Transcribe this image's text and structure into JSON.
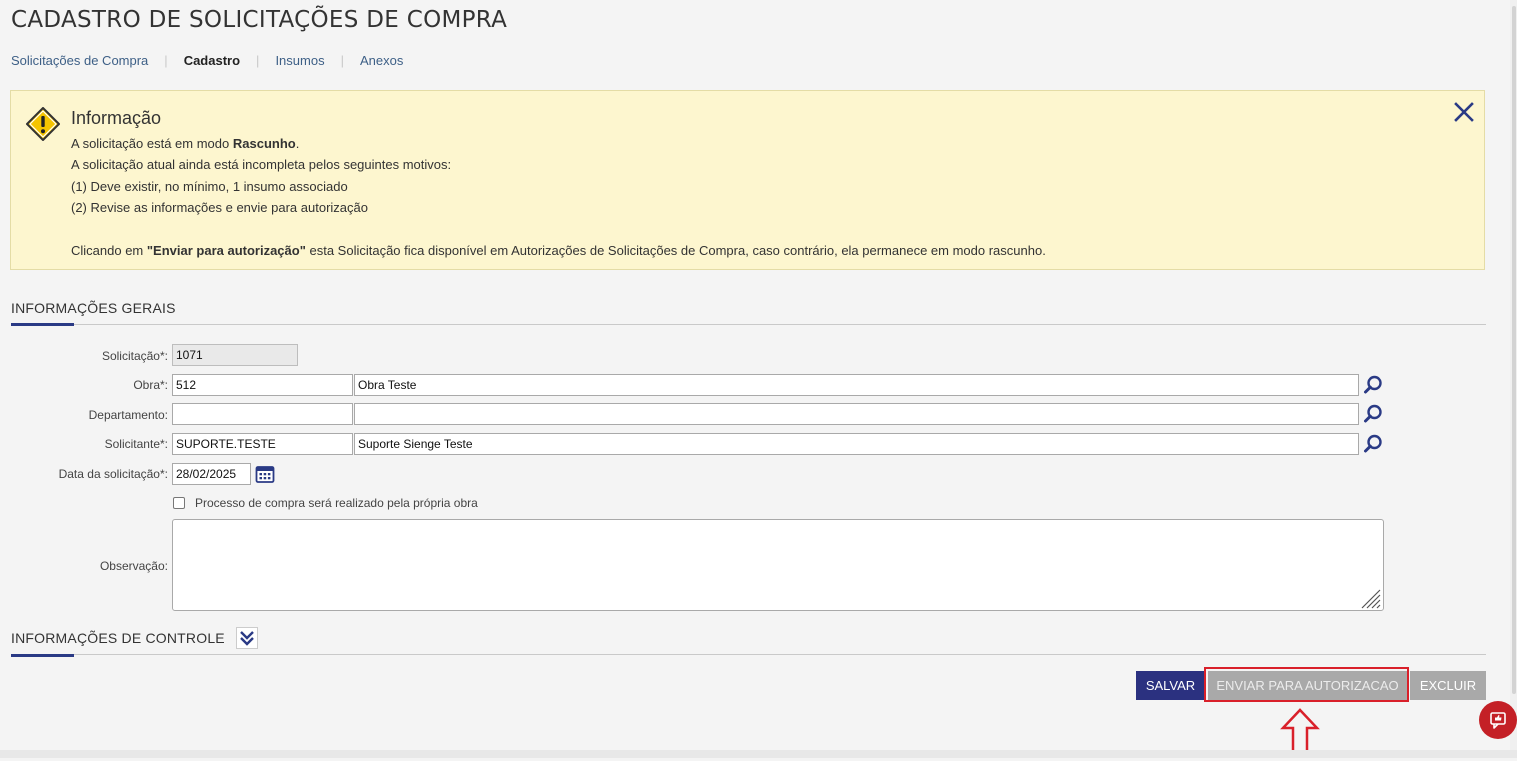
{
  "page_title": "CADASTRO DE SOLICITAÇÕES DE COMPRA",
  "breadcrumb": [
    {
      "label": "Solicitações de Compra",
      "active": false
    },
    {
      "label": "Cadastro",
      "active": true
    },
    {
      "label": "Insumos",
      "active": false
    },
    {
      "label": "Anexos",
      "active": false
    }
  ],
  "info_box": {
    "title": "Informação",
    "line1_pre": "A solicitação está em modo ",
    "line1_bold": "Rascunho",
    "line1_post": ".",
    "line2": "A solicitação atual ainda está incompleta pelos seguintes motivos:",
    "line3": "(1) Deve existir, no mínimo, 1 insumo associado",
    "line4": "(2) Revise as informações e envie para autorização",
    "line6_pre": "Clicando em ",
    "line6_bold": "\"Enviar para autorização\"",
    "line6_post": " esta Solicitação fica disponível em Autorizações de Solicitações de Compra, caso contrário, ela permanece em modo rascunho.",
    "icon": "warning-icon",
    "close_icon": "close-icon"
  },
  "general_section": {
    "title": "INFORMAÇÕES GERAIS",
    "fields": {
      "solicitacao": {
        "label": "Solicitação*:",
        "value": "1071"
      },
      "obra": {
        "label": "Obra*:",
        "code": "512",
        "name": "Obra Teste"
      },
      "departamento": {
        "label": "Departamento:",
        "code": "",
        "name": ""
      },
      "solicitante": {
        "label": "Solicitante*:",
        "code": "SUPORTE.TESTE",
        "name": "Suporte Sienge Teste"
      },
      "data": {
        "label": "Data da solicitação*:",
        "value": "28/02/2025"
      },
      "processo": {
        "label": "Processo de compra será realizado pela própria obra",
        "checked": false
      },
      "observacao": {
        "label": "Observação:",
        "value": ""
      }
    }
  },
  "control_section": {
    "title": "INFORMAÇÕES DE CONTROLE"
  },
  "buttons": {
    "salvar": "SALVAR",
    "enviar": "ENVIAR PARA AUTORIZACAO",
    "excluir": "EXCLUIR"
  },
  "colors": {
    "accent": "#2a3a85",
    "info_bg": "#fdf6cf",
    "primary_button": "#2b3180",
    "disabled_button": "#a9a9a9",
    "highlight": "#d9202a"
  }
}
